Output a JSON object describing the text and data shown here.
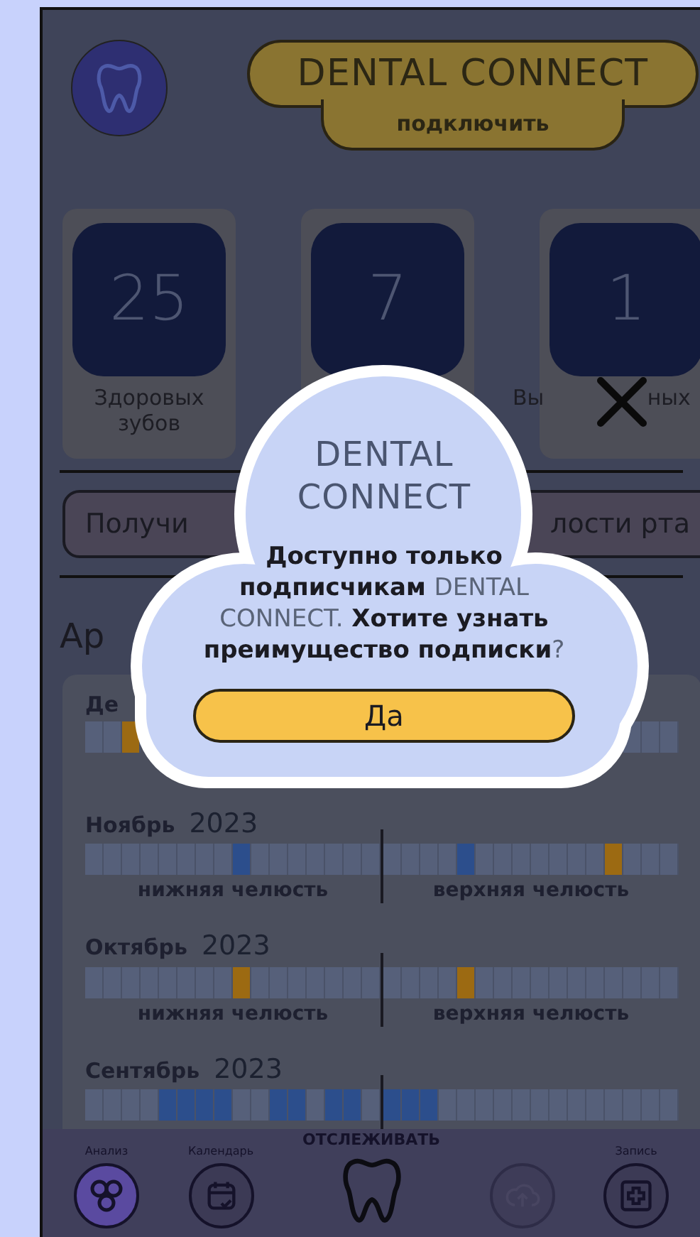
{
  "header": {
    "title": "DENTAL CONNECT",
    "connect_button": "подключить"
  },
  "stats": [
    {
      "value": "25",
      "label_parts": [
        "Здоровых зубов"
      ]
    },
    {
      "value": "7"
    },
    {
      "value": "1",
      "label_parts": [
        "Вы",
        "ных"
      ]
    }
  ],
  "banner_button": {
    "parts": [
      "Получи",
      "лости рта"
    ]
  },
  "archive": {
    "heading": "Ар",
    "months": [
      {
        "month": "Де",
        "lower": {
          "cells": [
            {
              "color": "#56607a"
            },
            {
              "color": "#56607a"
            },
            {
              "color": "#9c6a12"
            }
          ]
        },
        "upper": {
          "cells": [
            {
              "color": "#56607a"
            },
            {
              "color": "#56607a"
            },
            {
              "color": "#56607a"
            }
          ]
        }
      },
      {
        "month": "Ноябрь",
        "year": "2023",
        "lower": {
          "label": "нижняя челюсть",
          "cells": [
            {
              "color": "#56607a"
            },
            {
              "color": "#56607a"
            },
            {
              "color": "#56607a"
            },
            {
              "color": "#56607a"
            },
            {
              "color": "#56607a"
            },
            {
              "color": "#56607a"
            },
            {
              "color": "#56607a"
            },
            {
              "color": "#56607a"
            },
            {
              "color": "#2c4e8c"
            },
            {
              "color": "#56607a"
            },
            {
              "color": "#56607a"
            },
            {
              "color": "#56607a"
            },
            {
              "color": "#56607a"
            },
            {
              "color": "#56607a"
            },
            {
              "color": "#56607a"
            },
            {
              "color": "#56607a"
            }
          ]
        },
        "upper": {
          "label": "верхняя челюсть",
          "cells": [
            {
              "color": "#56607a"
            },
            {
              "color": "#56607a"
            },
            {
              "color": "#56607a"
            },
            {
              "color": "#56607a"
            },
            {
              "color": "#2c4e8c"
            },
            {
              "color": "#56607a"
            },
            {
              "color": "#56607a"
            },
            {
              "color": "#56607a"
            },
            {
              "color": "#56607a"
            },
            {
              "color": "#56607a"
            },
            {
              "color": "#56607a"
            },
            {
              "color": "#56607a"
            },
            {
              "color": "#9c6a12"
            },
            {
              "color": "#56607a"
            },
            {
              "color": "#56607a"
            },
            {
              "color": "#56607a"
            }
          ]
        }
      },
      {
        "month": "Октябрь",
        "year": "2023",
        "lower": {
          "label": "нижняя челюсть",
          "cells": [
            {
              "color": "#56607a"
            },
            {
              "color": "#56607a"
            },
            {
              "color": "#56607a"
            },
            {
              "color": "#56607a"
            },
            {
              "color": "#56607a"
            },
            {
              "color": "#56607a"
            },
            {
              "color": "#56607a"
            },
            {
              "color": "#56607a"
            },
            {
              "color": "#9c6a12"
            },
            {
              "color": "#56607a"
            },
            {
              "color": "#56607a"
            },
            {
              "color": "#56607a"
            },
            {
              "color": "#56607a"
            },
            {
              "color": "#56607a"
            },
            {
              "color": "#56607a"
            },
            {
              "color": "#56607a"
            }
          ]
        },
        "upper": {
          "label": "верхняя челюсть",
          "cells": [
            {
              "color": "#56607a"
            },
            {
              "color": "#56607a"
            },
            {
              "color": "#56607a"
            },
            {
              "color": "#56607a"
            },
            {
              "color": "#9c6a12"
            },
            {
              "color": "#56607a"
            },
            {
              "color": "#56607a"
            },
            {
              "color": "#56607a"
            },
            {
              "color": "#56607a"
            },
            {
              "color": "#56607a"
            },
            {
              "color": "#56607a"
            },
            {
              "color": "#56607a"
            },
            {
              "color": "#56607a"
            },
            {
              "color": "#56607a"
            },
            {
              "color": "#56607a"
            },
            {
              "color": "#56607a"
            }
          ]
        }
      },
      {
        "month": "Сентябрь",
        "year": "2023",
        "lower": {
          "cells": [
            {
              "color": "#56607a"
            },
            {
              "color": "#56607a"
            },
            {
              "color": "#56607a"
            },
            {
              "color": "#56607a"
            },
            {
              "color": "#2c4e8c"
            },
            {
              "color": "#2c4e8c"
            },
            {
              "color": "#2c4e8c"
            },
            {
              "color": "#2c4e8c"
            },
            {
              "color": "#56607a"
            },
            {
              "color": "#56607a"
            },
            {
              "color": "#2c4e8c"
            },
            {
              "color": "#2c4e8c"
            },
            {
              "color": "#56607a"
            },
            {
              "color": "#2c4e8c"
            },
            {
              "color": "#2c4e8c"
            },
            {
              "color": "#56607a"
            }
          ]
        },
        "upper": {
          "cells": [
            {
              "color": "#2c4e8c"
            },
            {
              "color": "#2c4e8c"
            },
            {
              "color": "#2c4e8c"
            },
            {
              "color": "#56607a"
            },
            {
              "color": "#56607a"
            },
            {
              "color": "#56607a"
            },
            {
              "color": "#56607a"
            },
            {
              "color": "#56607a"
            },
            {
              "color": "#56607a"
            },
            {
              "color": "#56607a"
            },
            {
              "color": "#56607a"
            },
            {
              "color": "#56607a"
            },
            {
              "color": "#56607a"
            },
            {
              "color": "#56607a"
            },
            {
              "color": "#56607a"
            },
            {
              "color": "#56607a"
            }
          ]
        }
      }
    ]
  },
  "nav": [
    {
      "kind": "analysis",
      "label": "Анализ",
      "selected": false,
      "disabled": false
    },
    {
      "kind": "calendar",
      "label": "Календарь",
      "selected": false,
      "disabled": false
    },
    {
      "kind": "tooth",
      "label": "ОТСЛЕЖИВАТЬ",
      "selected": true,
      "disabled": false
    },
    {
      "kind": "upload",
      "selected": false,
      "disabled": true
    },
    {
      "kind": "record",
      "label": "Запись",
      "selected": false,
      "disabled": false
    }
  ],
  "dialog": {
    "title": "DENTAL CONNECT",
    "message": [
      {
        "kind": "plain",
        "text": "Доступно только подписчикам "
      },
      {
        "kind": "brand",
        "text": "DENTAL CONNECT."
      },
      {
        "kind": "plain",
        "text": " Хотите узнать преимущество подписки"
      },
      {
        "kind": "brand",
        "text": "?"
      }
    ],
    "confirm_button": "Да"
  }
}
